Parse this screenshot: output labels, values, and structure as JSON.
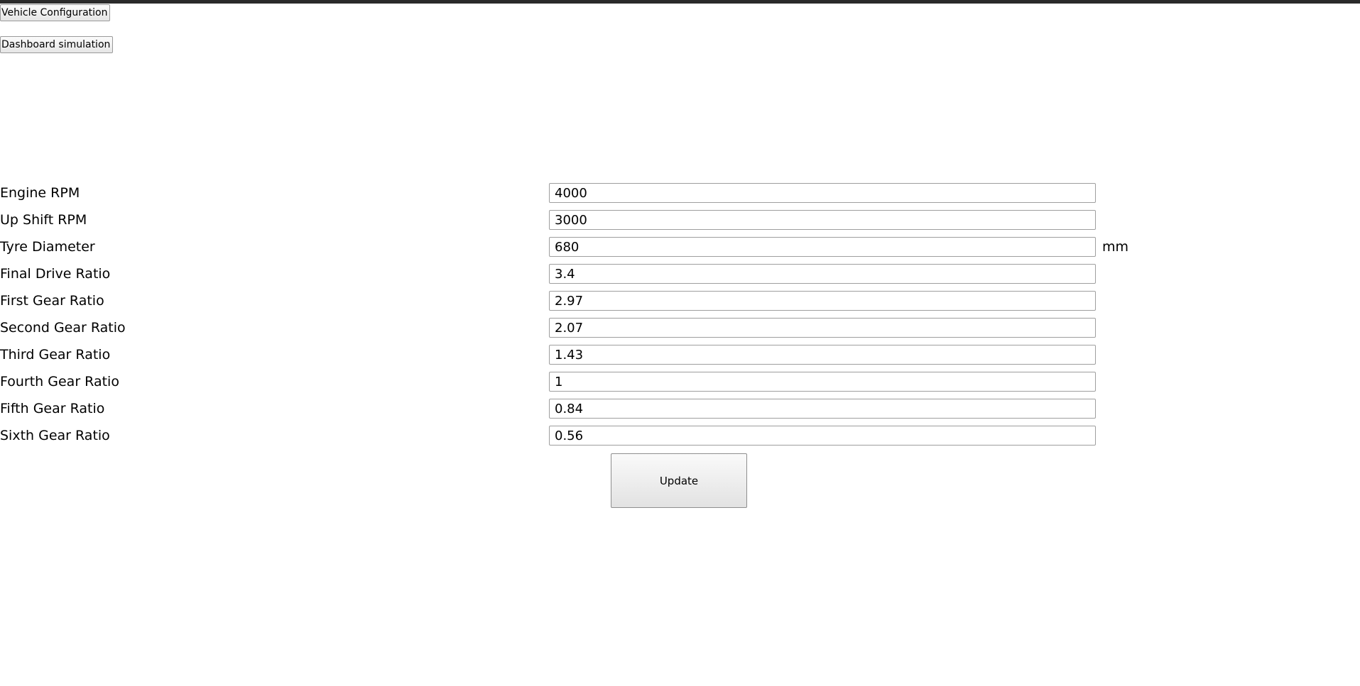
{
  "nav": {
    "vehicle_config_label": "Vehicle Configuration",
    "dashboard_sim_label": "Dashboard simulation"
  },
  "form": {
    "fields": [
      {
        "label": "Engine RPM",
        "value": "4000",
        "unit": ""
      },
      {
        "label": "Up Shift RPM",
        "value": "3000",
        "unit": ""
      },
      {
        "label": "Tyre Diameter",
        "value": "680",
        "unit": "mm"
      },
      {
        "label": "Final Drive Ratio",
        "value": "3.4",
        "unit": ""
      },
      {
        "label": "First Gear Ratio",
        "value": "2.97",
        "unit": ""
      },
      {
        "label": "Second Gear Ratio",
        "value": "2.07",
        "unit": ""
      },
      {
        "label": "Third Gear Ratio",
        "value": "1.43",
        "unit": ""
      },
      {
        "label": "Fourth Gear Ratio",
        "value": "1",
        "unit": ""
      },
      {
        "label": "Fifth Gear Ratio",
        "value": "0.84",
        "unit": ""
      },
      {
        "label": "Sixth Gear Ratio",
        "value": "0.56",
        "unit": ""
      }
    ],
    "update_label": "Update"
  }
}
